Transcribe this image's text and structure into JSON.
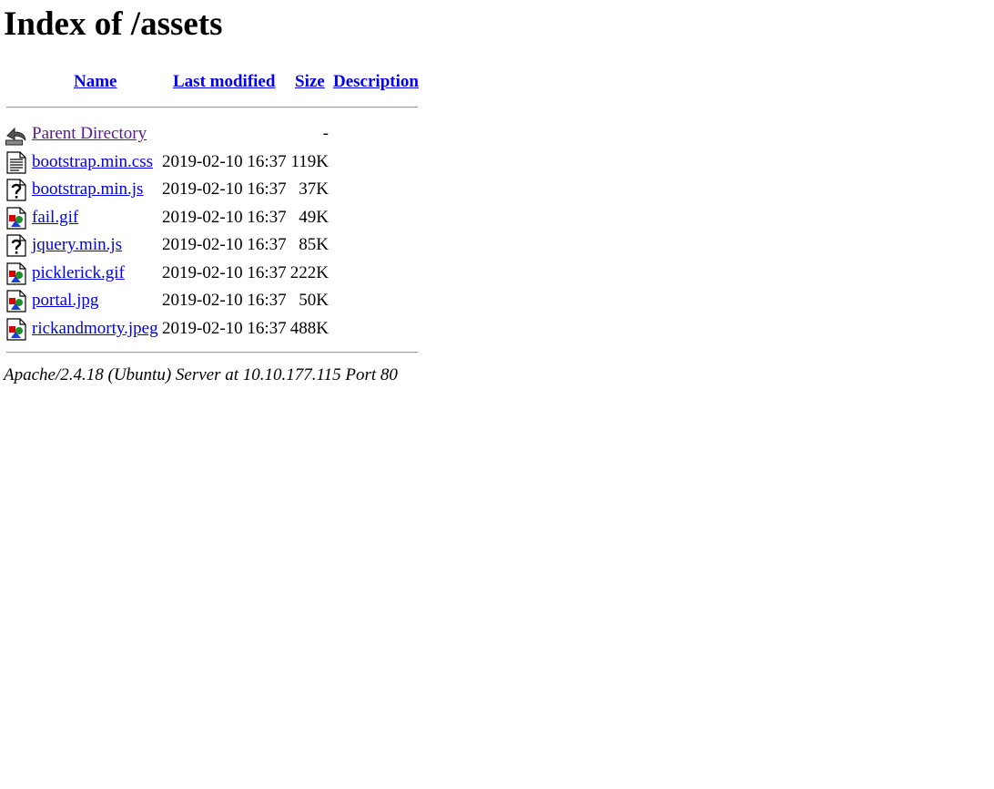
{
  "page": {
    "title": "Index of /assets"
  },
  "table": {
    "headers": {
      "name": "Name",
      "last_modified": "Last modified",
      "size": "Size",
      "description": "Description"
    },
    "rows": [
      {
        "name": "Parent Directory",
        "date": "",
        "size": "-",
        "icon": "back-icon"
      },
      {
        "name": "bootstrap.min.css",
        "date": "2019-02-10 16:37",
        "size": "119K",
        "icon": "text-file-icon"
      },
      {
        "name": "bootstrap.min.js",
        "date": "2019-02-10 16:37",
        "size": "37K",
        "icon": "unknown-file-icon"
      },
      {
        "name": "fail.gif",
        "date": "2019-02-10 16:37",
        "size": "49K",
        "icon": "image-file-icon"
      },
      {
        "name": "jquery.min.js",
        "date": "2019-02-10 16:37",
        "size": "85K",
        "icon": "unknown-file-icon"
      },
      {
        "name": "picklerick.gif",
        "date": "2019-02-10 16:37",
        "size": "222K",
        "icon": "image-file-icon"
      },
      {
        "name": "portal.jpg",
        "date": "2019-02-10 16:37",
        "size": "50K",
        "icon": "image-file-icon"
      },
      {
        "name": "rickandmorty.jpeg",
        "date": "2019-02-10 16:37",
        "size": "488K",
        "icon": "image-file-icon"
      }
    ]
  },
  "footer": {
    "server_signature": "Apache/2.4.18 (Ubuntu) Server at 10.10.177.115 Port 80"
  },
  "colors": {
    "link": "#0000ee",
    "visited_link": "#551a8b"
  }
}
